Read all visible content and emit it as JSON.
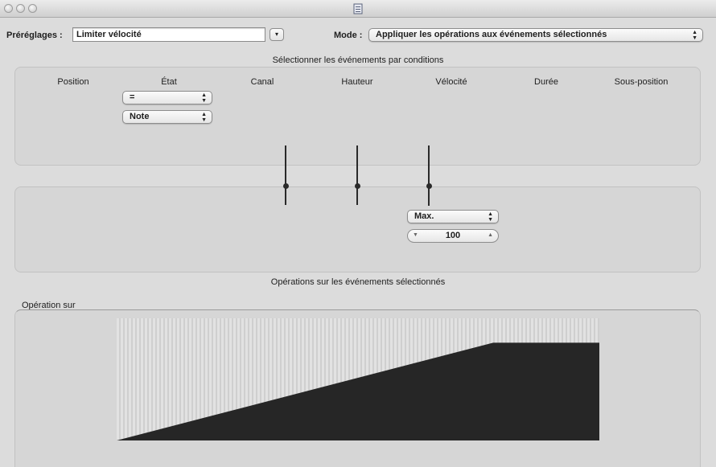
{
  "window": {
    "title_icon": "document-icon"
  },
  "presets": {
    "label": "Préréglages :",
    "value": "Limiter vélocité",
    "menu_button_glyph": "▾"
  },
  "mode": {
    "label": "Mode :",
    "value": "Appliquer les opérations aux événements sélectionnés"
  },
  "conditions": {
    "title": "Sélectionner les événements par conditions",
    "columns": [
      "Position",
      "État",
      "Canal",
      "Hauteur",
      "Vélocité",
      "Durée",
      "Sous-position"
    ],
    "etat_operator": "=",
    "etat_value": "Note"
  },
  "operations": {
    "velocity_operation": "Max.",
    "velocity_value": "100",
    "title": "Opérations sur les événements sélectionnés"
  },
  "operation_on": {
    "label": "Opération sur",
    "curve": {
      "start_level": 0,
      "plateau_start": 0.78,
      "plateau_level": 0.8
    }
  }
}
